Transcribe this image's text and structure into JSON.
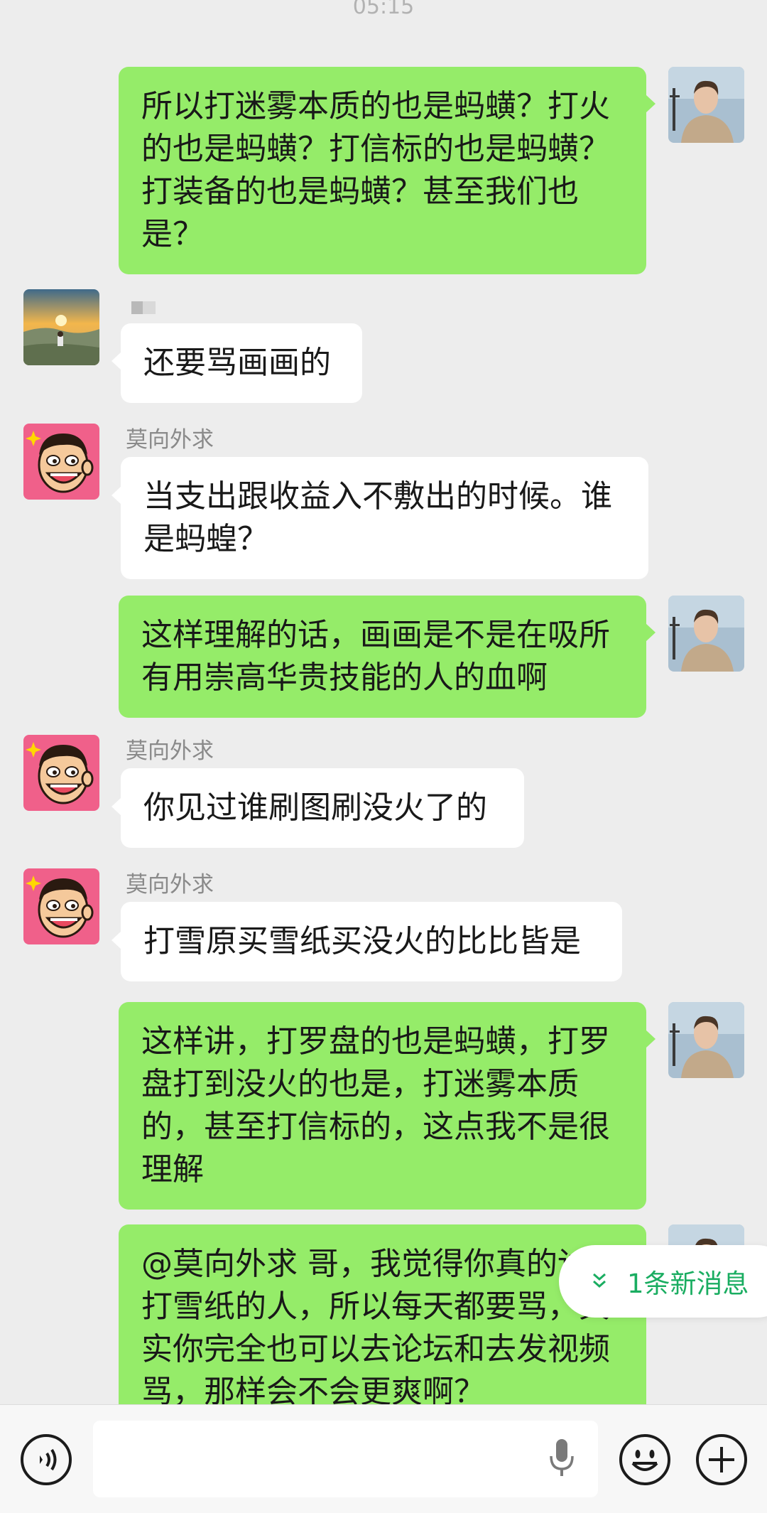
{
  "header": {
    "timestamp": "05:15"
  },
  "messages": [
    {
      "side": "right",
      "text": "所以打迷雾本质的也是蚂蟥？打火的也是蚂蟥？打信标的也是蚂蟥？打装备的也是蚂蟥？甚至我们也是？"
    },
    {
      "side": "left",
      "text": "还要骂画画的"
    },
    {
      "side": "left",
      "sender": "莫向外求",
      "text": "当支出跟收益入不敷出的时候。谁是蚂蝗？"
    },
    {
      "side": "right",
      "text": "这样理解的话，画画是不是在吸所有用崇高华贵技能的人的血啊"
    },
    {
      "side": "left",
      "sender": "莫向外求",
      "text": "你见过谁刷图刷没火了的"
    },
    {
      "side": "left",
      "sender": "莫向外求",
      "text": "打雪原买雪纸买没火的比比皆是"
    },
    {
      "side": "right",
      "text": "这样讲，打罗盘的也是蚂蟥，打罗盘打到没火的也是，打迷雾本质的，甚至打信标的，这点我不是很理解"
    },
    {
      "side": "right",
      "text": "@莫向外求  哥，我觉得你真的讨厌打雪纸的人，所以每天都要骂，其实你完全也可以去论坛和去发视频骂，那样会不会更爽啊？"
    }
  ],
  "new_message_badge": {
    "label": "1条新消息"
  },
  "input_bar": {
    "voice_icon": "voice-icon",
    "mic_icon": "mic-icon",
    "emoji_icon": "emoji-icon",
    "plus_icon": "plus-icon"
  },
  "colors": {
    "background": "#ededed",
    "outgoing_bubble": "#95ec69",
    "incoming_bubble": "#ffffff",
    "accent": "#1aad61"
  }
}
